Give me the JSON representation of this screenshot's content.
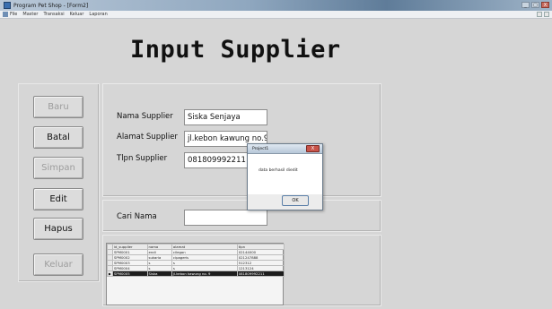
{
  "window": {
    "title": "Program Pet Shop - [Form2]",
    "controls": {
      "minimize": "_",
      "maximize": "□",
      "close": "X"
    }
  },
  "menu": {
    "items": [
      "File",
      "Master",
      "Transaksi",
      "Keluar",
      "Laporan"
    ]
  },
  "page": {
    "heading": "Input Supplier"
  },
  "buttons": {
    "baru": "Baru",
    "batal": "Batal",
    "simpan": "Simpan",
    "edit": "Edit",
    "hapus": "Hapus",
    "keluar": "Keluar"
  },
  "form": {
    "nama_label": "Nama Supplier",
    "nama_value": "Siska Senjaya",
    "alamat_label": "Alamat Supplier",
    "alamat_value": "jl.kebon kawung no.9",
    "tlp_label": "Tlpn Supplier",
    "tlp_value": "081809992211",
    "cari_label": "Cari Nama",
    "cari_value": ""
  },
  "grid": {
    "columns": [
      "id_supplier",
      "nama",
      "alamat",
      "tlpn"
    ],
    "rows": [
      [
        "SPM0001",
        "endi",
        "cilegon",
        "02144000"
      ],
      [
        "SPM0002",
        "sukaria",
        "cipageris",
        "021247888"
      ],
      [
        "SPM0003",
        "s",
        "s",
        "512312"
      ],
      [
        "SPM0004",
        "s",
        "s",
        "1213124"
      ],
      [
        "SPM0005",
        "Siska",
        "jl.kebon kawung no. 9",
        "081809992211"
      ]
    ],
    "selected_row": 4
  },
  "msgbox": {
    "title": "Project1",
    "message": "data berhasil diedit",
    "ok_label": "OK",
    "close": "X"
  }
}
